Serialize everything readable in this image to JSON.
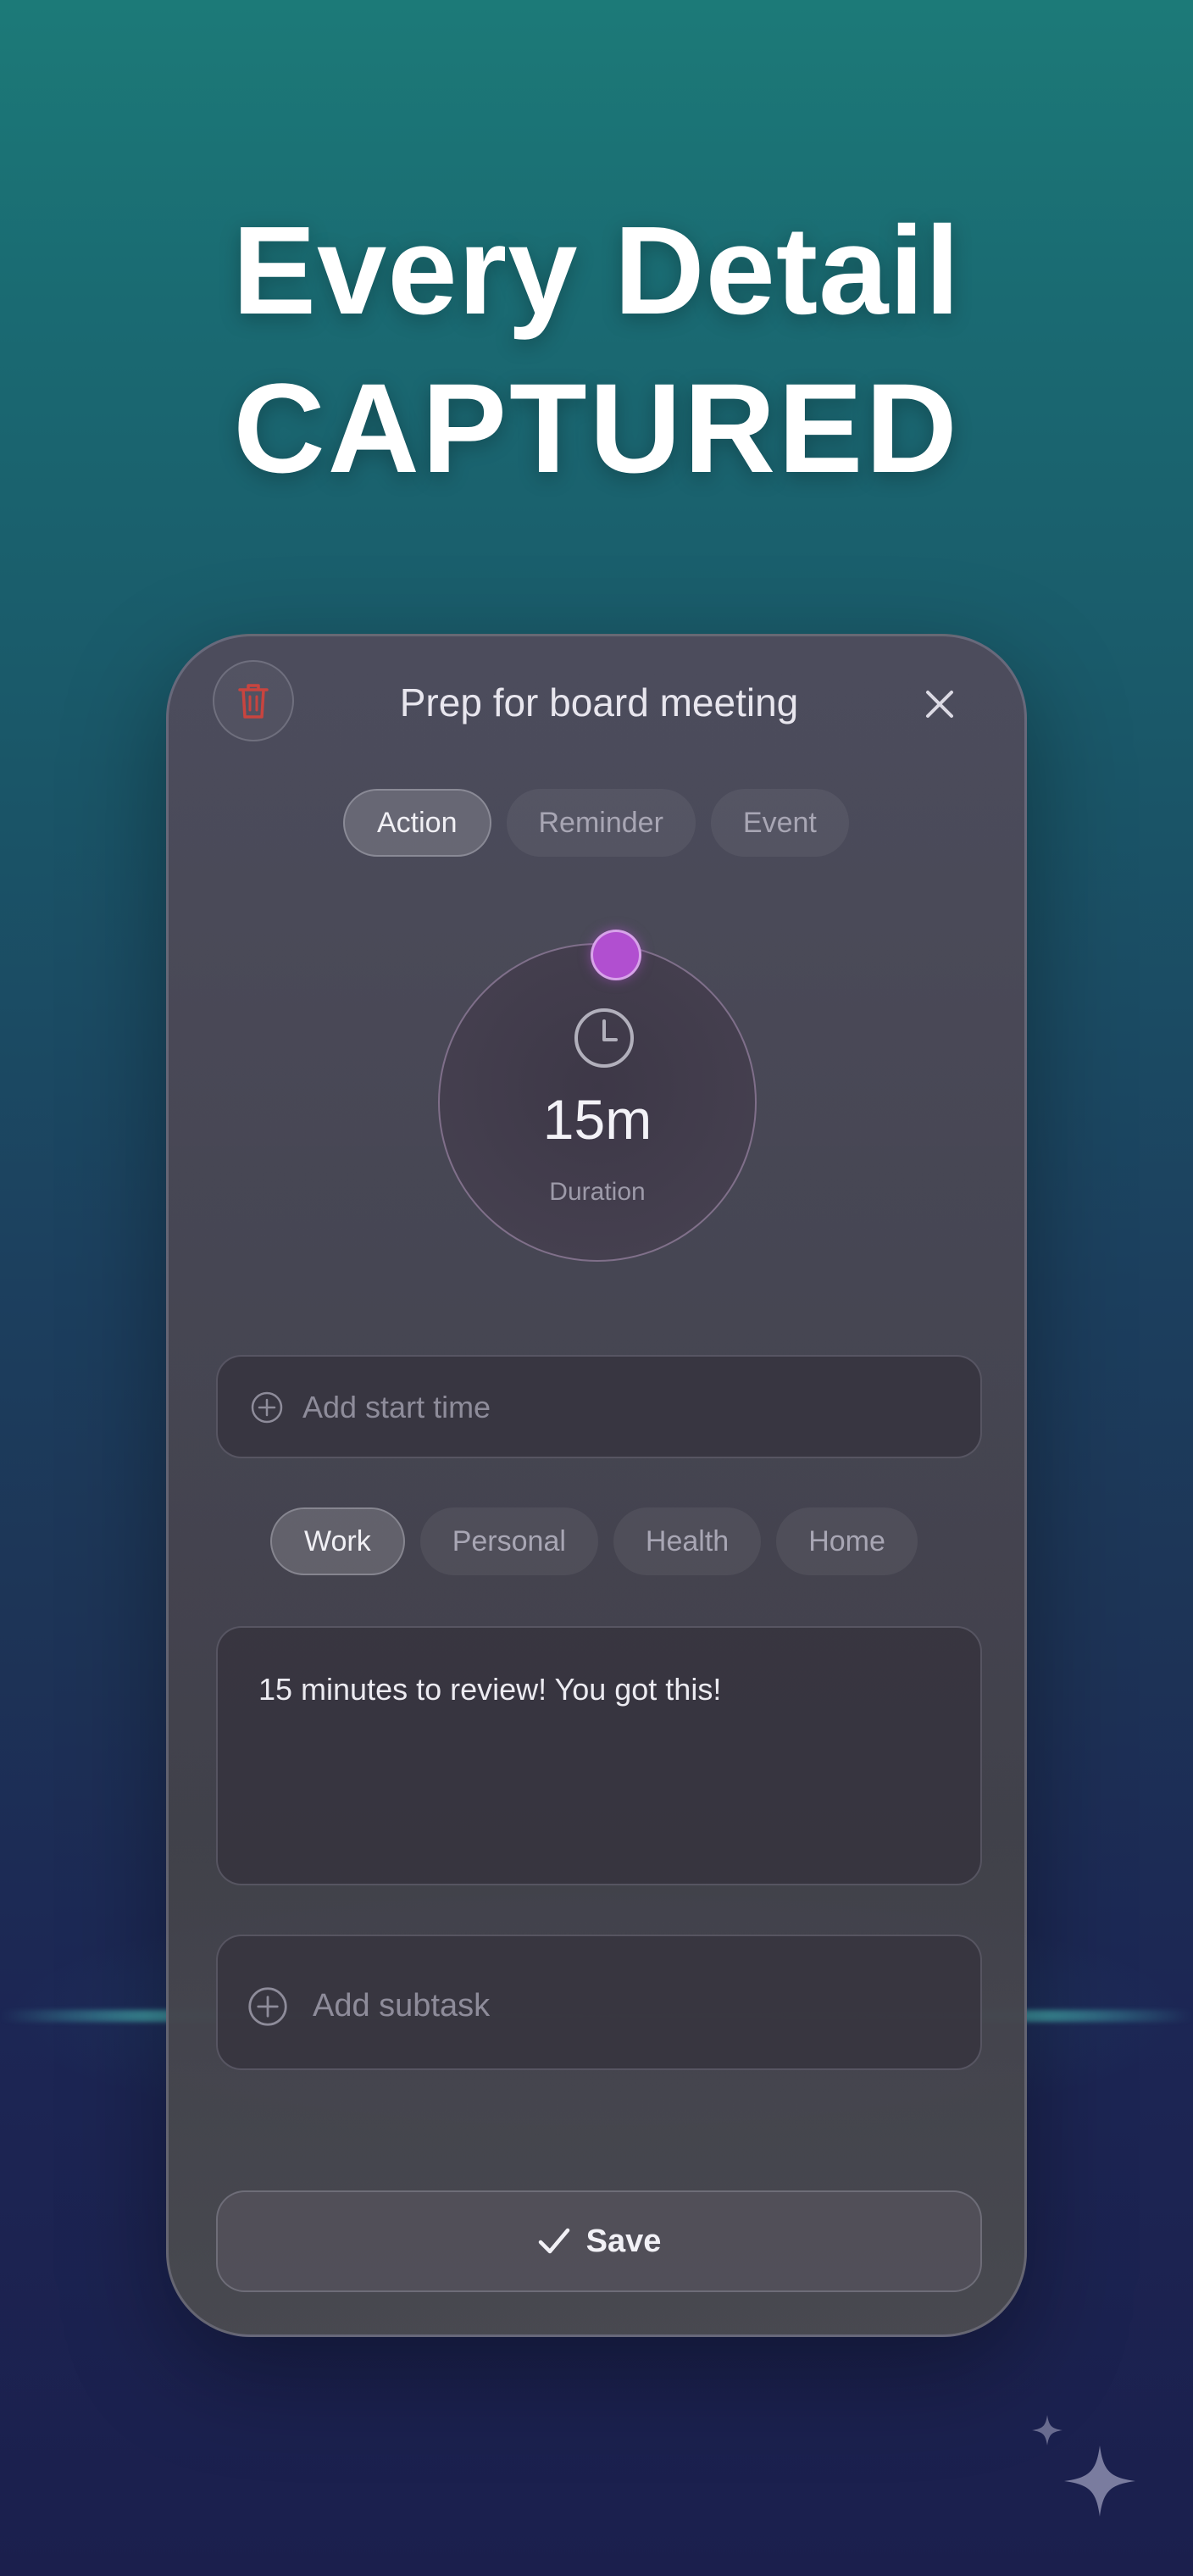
{
  "hero": {
    "line1": "Every Detail",
    "line2": "CAPTURED"
  },
  "task": {
    "title": "Prep for board meeting",
    "types": [
      {
        "label": "Action",
        "selected": true
      },
      {
        "label": "Reminder",
        "selected": false
      },
      {
        "label": "Event",
        "selected": false
      }
    ],
    "duration": {
      "value": "15m",
      "label": "Duration"
    },
    "start_time_placeholder": "Add start time",
    "categories": [
      {
        "label": "Work",
        "selected": true
      },
      {
        "label": "Personal",
        "selected": false
      },
      {
        "label": "Health",
        "selected": false
      },
      {
        "label": "Home",
        "selected": false
      }
    ],
    "note": "15 minutes to review! You got this!",
    "subtask_placeholder": "Add subtask",
    "save_label": "Save"
  },
  "icons": {
    "delete": "trash-icon",
    "close": "close-icon",
    "duration": "clock-icon",
    "add": "plus-circle-icon",
    "save": "checkmark-icon",
    "decoration": "sparkle-icon"
  },
  "colors": {
    "accent_knob": "#b14fd0",
    "delete_red": "#c8443f"
  }
}
